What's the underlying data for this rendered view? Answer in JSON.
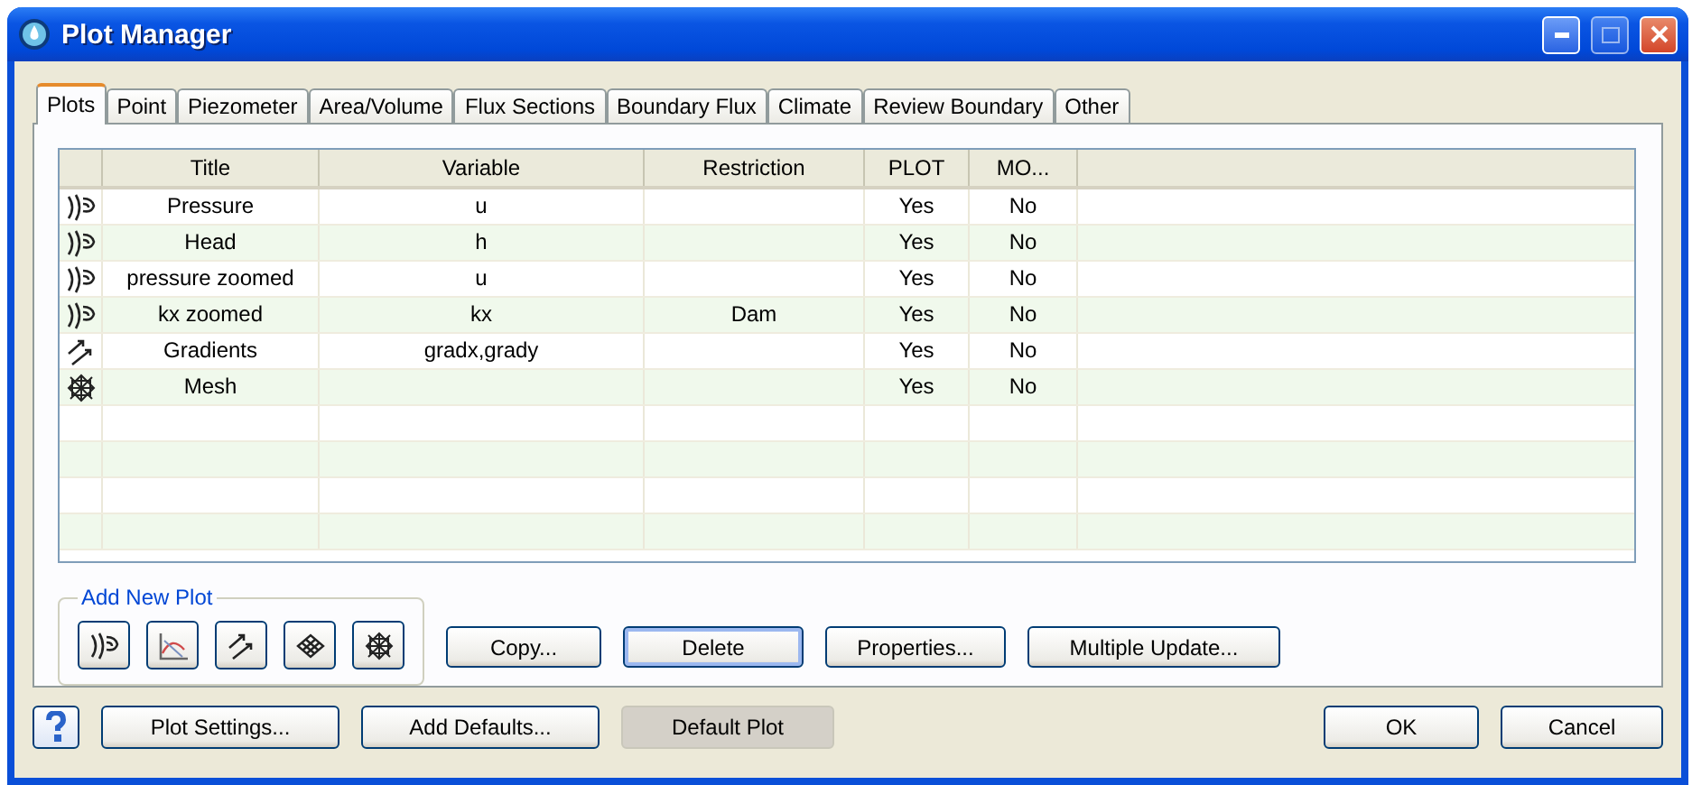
{
  "window": {
    "title": "Plot Manager"
  },
  "tabs": [
    {
      "label": "Plots",
      "selected": true
    },
    {
      "label": "Point",
      "selected": false
    },
    {
      "label": "Piezometer",
      "selected": false
    },
    {
      "label": "Area/Volume",
      "selected": false
    },
    {
      "label": "Flux Sections",
      "selected": false
    },
    {
      "label": "Boundary Flux",
      "selected": false
    },
    {
      "label": "Climate",
      "selected": false
    },
    {
      "label": "Review Boundary",
      "selected": false
    },
    {
      "label": "Other",
      "selected": false
    }
  ],
  "table": {
    "columns": [
      "Title",
      "Variable",
      "Restriction",
      "PLOT",
      "MO..."
    ],
    "rows": [
      {
        "kind": "contour",
        "cells": [
          "Pressure",
          "u",
          "",
          "Yes",
          "No"
        ]
      },
      {
        "kind": "contour",
        "cells": [
          "Head",
          "h",
          "",
          "Yes",
          "No"
        ]
      },
      {
        "kind": "contour",
        "cells": [
          "pressure zoomed",
          "u",
          "",
          "Yes",
          "No"
        ]
      },
      {
        "kind": "contour",
        "cells": [
          "kx zoomed",
          "kx",
          "Dam",
          "Yes",
          "No"
        ]
      },
      {
        "kind": "vector",
        "cells": [
          "Gradients",
          "gradx,grady",
          "",
          "Yes",
          "No"
        ]
      },
      {
        "kind": "mesh",
        "cells": [
          "Mesh",
          "",
          "",
          "Yes",
          "No"
        ]
      }
    ]
  },
  "add_new_plot": {
    "label": "Add New Plot",
    "buttons": [
      {
        "kind": "contour"
      },
      {
        "kind": "graph"
      },
      {
        "kind": "vector"
      },
      {
        "kind": "grid"
      },
      {
        "kind": "mesh"
      }
    ]
  },
  "actions": [
    {
      "label": "Copy...",
      "focused": false
    },
    {
      "label": "Delete",
      "focused": true
    },
    {
      "label": "Properties...",
      "focused": false
    },
    {
      "label": "Multiple Update...",
      "focused": false
    }
  ],
  "footer": {
    "left": [
      {
        "label": "Plot Settings...",
        "pressed": false
      },
      {
        "label": "Add Defaults...",
        "pressed": false
      },
      {
        "label": "Default Plot",
        "pressed": true
      }
    ],
    "right": [
      {
        "label": "OK"
      },
      {
        "label": "Cancel"
      }
    ]
  }
}
